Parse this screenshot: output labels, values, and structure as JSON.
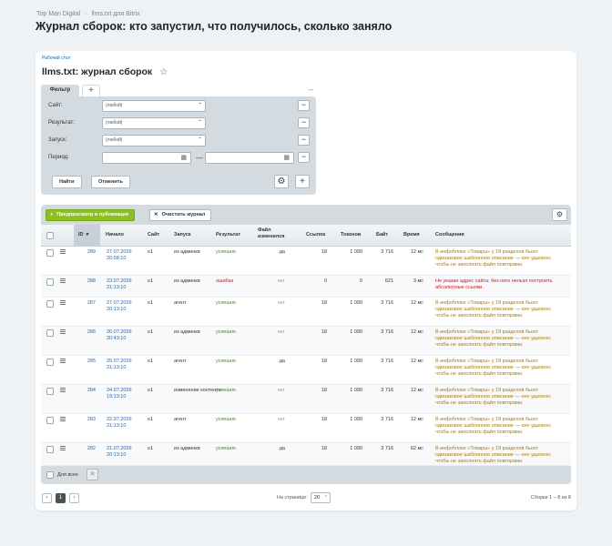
{
  "breadcrumbs": [
    "Top Man Digital",
    "llms.txt для Bitrix"
  ],
  "page_title": "Журнал сборок: кто запустил, что получилось, сколько заняло",
  "card": {
    "desktop_link": "Рабочий стол",
    "title": "llms.txt: журнал сборок",
    "star_icon": "star-icon"
  },
  "filter": {
    "tab_label": "Фильтр",
    "add_tab": "+",
    "collapse": "–",
    "rows": [
      {
        "label": "Сайт:",
        "value": "(любой)"
      },
      {
        "label": "Результат:",
        "value": "(любой)"
      },
      {
        "label": "Запуск:",
        "value": "(любой)"
      }
    ],
    "period_label": "Период:",
    "period_dash": "—",
    "remove": "−",
    "find_button": "Найти",
    "cancel_button": "Отменить",
    "gear": "⚙",
    "add": "+"
  },
  "toolbar": {
    "preview_button": "Предпросмотр и публикация",
    "preview_icon": "+",
    "clear_button": "Очистить журнал",
    "clear_icon": "✕",
    "gear": "⚙"
  },
  "columns": {
    "id": "ID",
    "start": "Начало",
    "site": "Сайт",
    "launch": "Запуск",
    "result": "Результат",
    "changed": "Файл изменился",
    "links": "Ссылок",
    "tokens": "Токенов",
    "bytes": "Байт",
    "time": "Время",
    "messages": "Сообщения"
  },
  "rows": [
    {
      "id": "289",
      "date": "27.07.2026",
      "time": "20:58:10",
      "site": "s1",
      "launch": "из админки",
      "result": "успешно",
      "status": "ok",
      "changed": "да",
      "links": "18",
      "tokens": "1 090",
      "bytes": "3 716",
      "duration": "12 мс",
      "message": "В инфоблоке «Товары» у 18 разделов было одинаковое шаблонное описание — оно удалено, чтобы не заполнять файл повторами."
    },
    {
      "id": "288",
      "date": "23.07.2026",
      "time": "21:13:10",
      "site": "s1",
      "launch": "из админки",
      "result": "ошибка",
      "status": "err",
      "changed": "нет",
      "links": "0",
      "tokens": "0",
      "bytes": "621",
      "duration": "3 мс",
      "message": "Не указан адрес сайта: без него нельзя построить абсолютные ссылки."
    },
    {
      "id": "287",
      "date": "27.07.2026",
      "time": "20:13:10",
      "site": "s1",
      "launch": "агент",
      "result": "успешно",
      "status": "ok",
      "changed": "нет",
      "links": "18",
      "tokens": "1 090",
      "bytes": "3 716",
      "duration": "12 мс",
      "message": "В инфоблоке «Товары» у 18 разделов было одинаковое шаблонное описание — оно удалено, чтобы не заполнять файл повторами."
    },
    {
      "id": "286",
      "date": "26.07.2026",
      "time": "20:43:10",
      "site": "s1",
      "launch": "из админки",
      "result": "успешно",
      "status": "ok",
      "changed": "нет",
      "links": "18",
      "tokens": "1 090",
      "bytes": "3 716",
      "duration": "12 мс",
      "message": "В инфоблоке «Товары» у 18 разделов было одинаковое шаблонное описание — оно удалено, чтобы не заполнять файл повторами."
    },
    {
      "id": "285",
      "date": "25.07.2026",
      "time": "21:13:10",
      "site": "s1",
      "launch": "агент",
      "result": "успешно",
      "status": "ok",
      "changed": "да",
      "links": "18",
      "tokens": "1 090",
      "bytes": "3 716",
      "duration": "12 мс",
      "message": "В инфоблоке «Товары» у 18 разделов было одинаковое шаблонное описание — оно удалено, чтобы не заполнять файл повторами."
    },
    {
      "id": "284",
      "date": "24.07.2026",
      "time": "19:13:10",
      "site": "s1",
      "launch": "изменение контента",
      "result": "успешно",
      "status": "ok",
      "changed": "нет",
      "links": "18",
      "tokens": "1 090",
      "bytes": "3 716",
      "duration": "12 мс",
      "message": "В инфоблоке «Товары» у 18 разделов было одинаковое шаблонное описание — оно удалено, чтобы не заполнять файл повторами."
    },
    {
      "id": "283",
      "date": "22.07.2026",
      "time": "21:13:10",
      "site": "s1",
      "launch": "агент",
      "result": "успешно",
      "status": "ok",
      "changed": "нет",
      "links": "18",
      "tokens": "1 090",
      "bytes": "3 716",
      "duration": "12 мс",
      "message": "В инфоблоке «Товары» у 18 разделов было одинаковое шаблонное описание — оно удалено, чтобы не заполнять файл повторами."
    },
    {
      "id": "282",
      "date": "21.07.2026",
      "time": "20:13:10",
      "site": "s1",
      "launch": "из админки",
      "result": "успешно",
      "status": "ok",
      "changed": "да",
      "links": "18",
      "tokens": "1 090",
      "bytes": "3 716",
      "duration": "62 мс",
      "message": "В инфоблоке «Товары» у 18 разделов было одинаковое шаблонное описание — оно удалено, чтобы не заполнять файл повторами."
    }
  ],
  "footer": {
    "for_all": "Для всех",
    "delete": "✕"
  },
  "pagination": {
    "prev": "‹",
    "current": "1",
    "next": "›",
    "per_page_label": "На странице:",
    "per_page_value": "20",
    "summary": "Сборки 1 – 8 из 8"
  },
  "colors": {
    "accent_green": "#8cbf1f",
    "link": "#2066b0",
    "success": "#3a8a10",
    "error": "#d01818",
    "warning": "#b07808"
  }
}
